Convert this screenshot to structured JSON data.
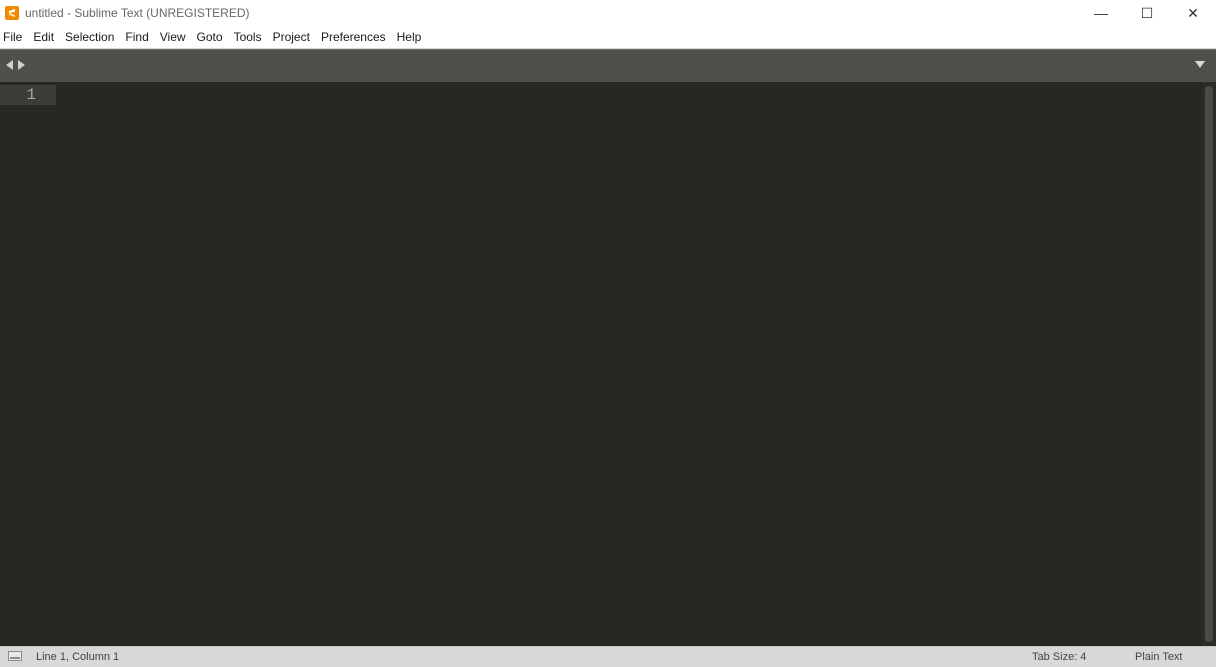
{
  "window": {
    "title": "untitled - Sublime Text (UNREGISTERED)",
    "icon": "sublime-text-logo-icon",
    "controls": {
      "minimize": "—",
      "maximize": "☐",
      "close": "✕"
    }
  },
  "menu": {
    "items": [
      "File",
      "Edit",
      "Selection",
      "Find",
      "View",
      "Goto",
      "Tools",
      "Project",
      "Preferences",
      "Help"
    ]
  },
  "tabbar": {
    "nav_left_icon": "arrow-left-icon",
    "nav_right_icon": "arrow-right-icon",
    "dropdown_icon": "chevron-down-icon"
  },
  "editor": {
    "line_numbers": [
      "1"
    ],
    "content": "",
    "colors": {
      "background": "#272822",
      "line_highlight": "#3c3d37",
      "gutter_text": "#a8a89c"
    }
  },
  "status": {
    "position": "Line 1, Column 1",
    "tab_size": "Tab Size: 4",
    "syntax": "Plain Text"
  }
}
